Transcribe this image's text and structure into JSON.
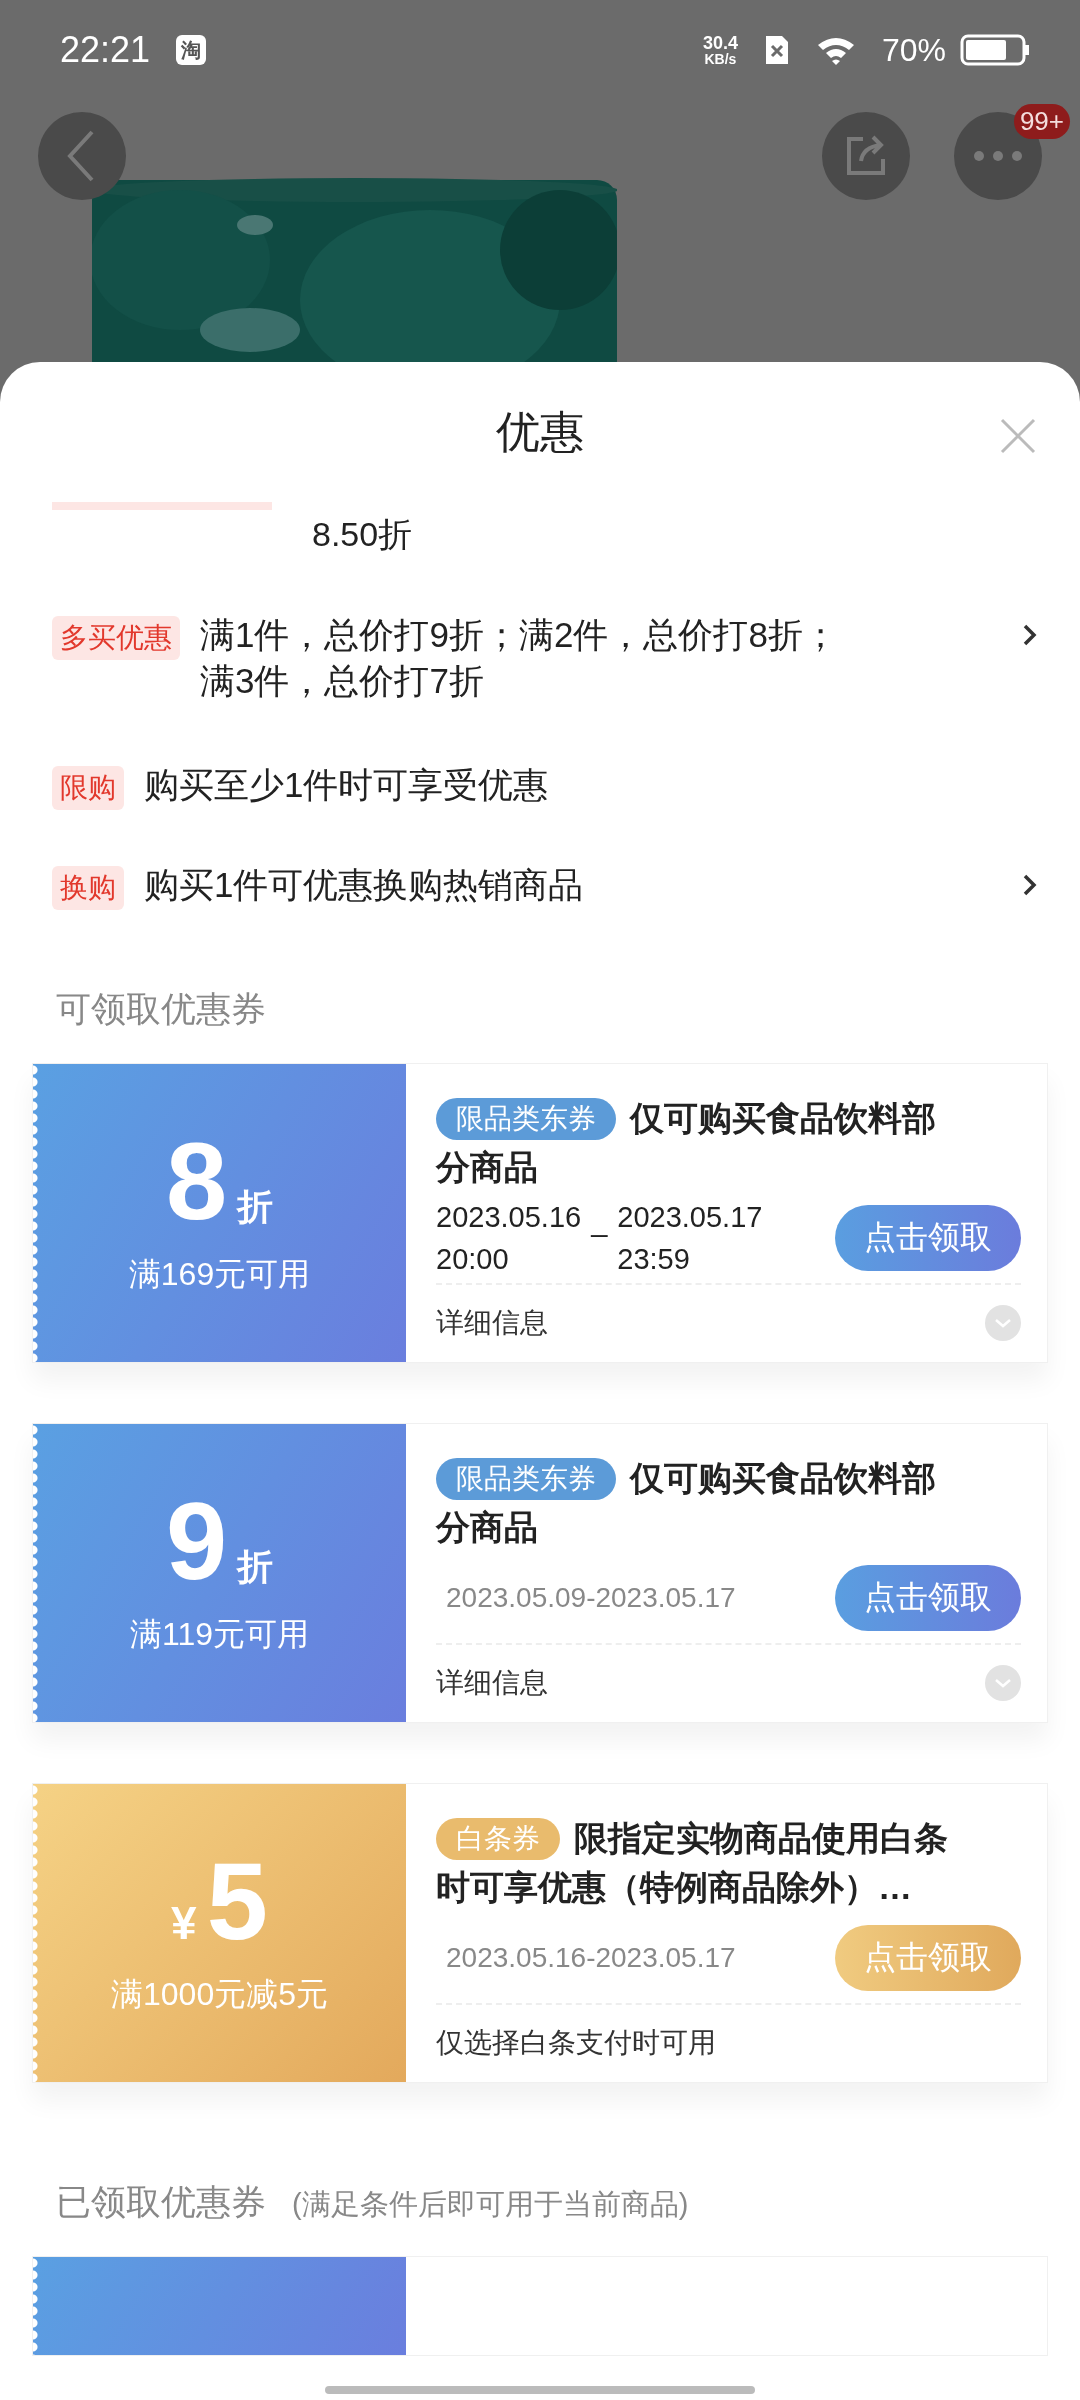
{
  "status_bar": {
    "time": "22:21",
    "app_icon": "淘",
    "net_speed": "30.4",
    "net_unit": "KB/s",
    "battery": "70%"
  },
  "header": {
    "badge": "99+"
  },
  "sheet": {
    "title": "优惠"
  },
  "promotions": [
    {
      "kind": "clipped",
      "text": "8.50折",
      "has_arrow": false
    },
    {
      "kind": "full",
      "tag": "多买优惠",
      "text": "满1件，总价打9折；满2件，总价打8折；满3件，总价打7折",
      "has_arrow": true
    },
    {
      "kind": "full",
      "tag": "限购",
      "text": "购买至少1件时可享受优惠",
      "has_arrow": false
    },
    {
      "kind": "full",
      "tag": "换购",
      "text": "购买1件可优惠换购热销商品",
      "has_arrow": true
    }
  ],
  "available_title": "可领取优惠券",
  "coupons": [
    {
      "kind": "blue",
      "value": "8",
      "value_suffix": "折",
      "condition": "满169元可用",
      "tag": "限品类东券",
      "title": "仅可购买食品饮料部分商品",
      "validity": {
        "kind": "split",
        "start_date": "2023.05.16",
        "start_time": "20:00",
        "separator": "_",
        "end_date": "2023.05.17",
        "end_time": "23:59"
      },
      "button": "点击领取",
      "footer": "详细信息",
      "expandable": true
    },
    {
      "kind": "blue",
      "value": "9",
      "value_suffix": "折",
      "condition": "满119元可用",
      "tag": "限品类东券",
      "title": "仅可购买食品饮料部分商品",
      "validity": {
        "kind": "single",
        "text": "2023.05.09-2023.05.17"
      },
      "button": "点击领取",
      "footer": "详细信息",
      "expandable": true
    },
    {
      "kind": "gold",
      "value_prefix": "¥",
      "value": "5",
      "condition": "满1000元减5元",
      "tag": "白条券",
      "title": "限指定实物商品使用白条时可享优惠（特例商品除外）…",
      "validity": {
        "kind": "single",
        "text": "2023.05.16-2023.05.17"
      },
      "button": "点击领取",
      "footer": "仅选择白条支付时可用",
      "expandable": false
    }
  ],
  "claimed_title": "已领取优惠券",
  "claimed_note": "(满足条件后即可用于当前商品)",
  "claimed_coupons": [
    {
      "kind": "blue"
    }
  ]
}
